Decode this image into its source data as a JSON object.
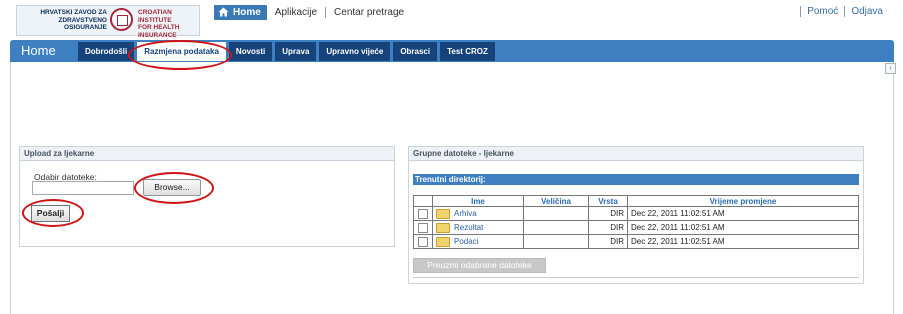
{
  "logo": {
    "text_left": [
      "HRVATSKI ZAVOD ZA",
      "ZDRAVSTVENO",
      "OSIGURANJE"
    ],
    "text_right": [
      "CROATIAN INSTITUTE",
      "FOR HEALTH",
      "INSURANCE"
    ]
  },
  "topnav": {
    "home": "Home",
    "links": [
      "Aplikacije",
      "Centar pretrage"
    ]
  },
  "rightnav": [
    "Pomoć",
    "Odjava"
  ],
  "tabbar": {
    "home": "Home",
    "tabs": [
      "Dobrodošli",
      "Razmjena podataka",
      "Novosti",
      "Uprava",
      "Upravno vijeće",
      "Obrasci",
      "Test CROZ"
    ],
    "active_index": 1
  },
  "upload_panel": {
    "title": "Upload za ljekarne",
    "field_label": "Odabir datoteke:",
    "browse": "Browse...",
    "send": "Pošalji"
  },
  "group_panel": {
    "title": "Grupne datoteke - ljekarne",
    "current_dir": "Trenutni direktorij:",
    "columns": [
      "Ime",
      "Veličina",
      "Vrsta",
      "Vrijeme promjene"
    ],
    "rows": [
      {
        "name": "Arhiva",
        "size": "",
        "type": "DIR",
        "modified": "Dec 22, 2011 11:02:51 AM"
      },
      {
        "name": "Rezultat",
        "size": "",
        "type": "DIR",
        "modified": "Dec 22, 2011 11:02:51 AM"
      },
      {
        "name": "Podaci",
        "size": "",
        "type": "DIR",
        "modified": "Dec 22, 2011 11:02:51 AM"
      }
    ],
    "download_button": "Preuzmi odabrane datoteke"
  },
  "colors": {
    "accent_blue": "#3d7fc1",
    "tab_dark": "#15437a",
    "highlight_ring": "#d01414"
  },
  "icons": [
    "house-icon",
    "folder-icon",
    "checkbox"
  ]
}
